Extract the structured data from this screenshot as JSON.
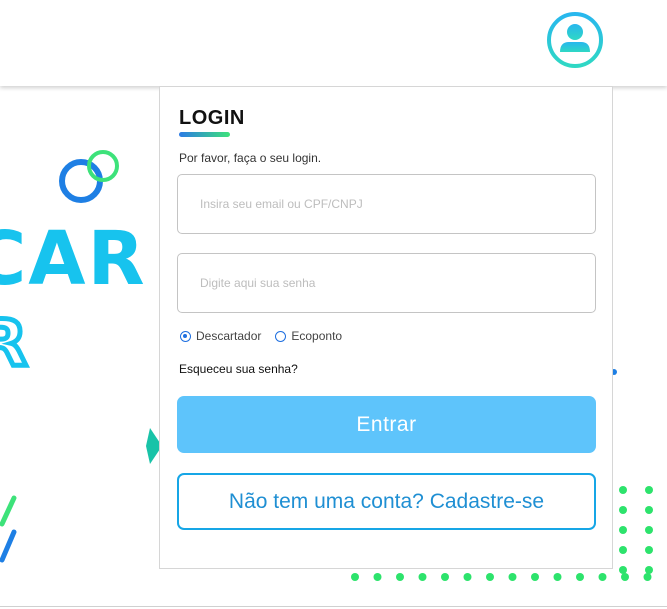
{
  "header": {
    "profile_icon": "user-circle-icon"
  },
  "background": {
    "word_partial": "CAR",
    "letter_partial": "R"
  },
  "login": {
    "title": "LOGIN",
    "subtitle": "Por favor, faça o seu login.",
    "email_placeholder": "Insira seu email ou CPF/CNPJ",
    "email_value": "",
    "password_placeholder": "Digite aqui sua senha",
    "password_value": "",
    "user_type_options": [
      "Descartador",
      "Ecoponto"
    ],
    "user_type_selected": "Descartador",
    "forgot_password": "Esqueceu sua senha?",
    "submit_label": "Entrar",
    "signup_label": "Não tem uma conta? Cadastre-se"
  },
  "colors": {
    "brand_blue": "#17c3ee",
    "accent_green": "#2de36c",
    "primary_button": "#5ec4fb",
    "outline_button": "#16a6e6",
    "radio_accent": "#1e6fe0"
  }
}
